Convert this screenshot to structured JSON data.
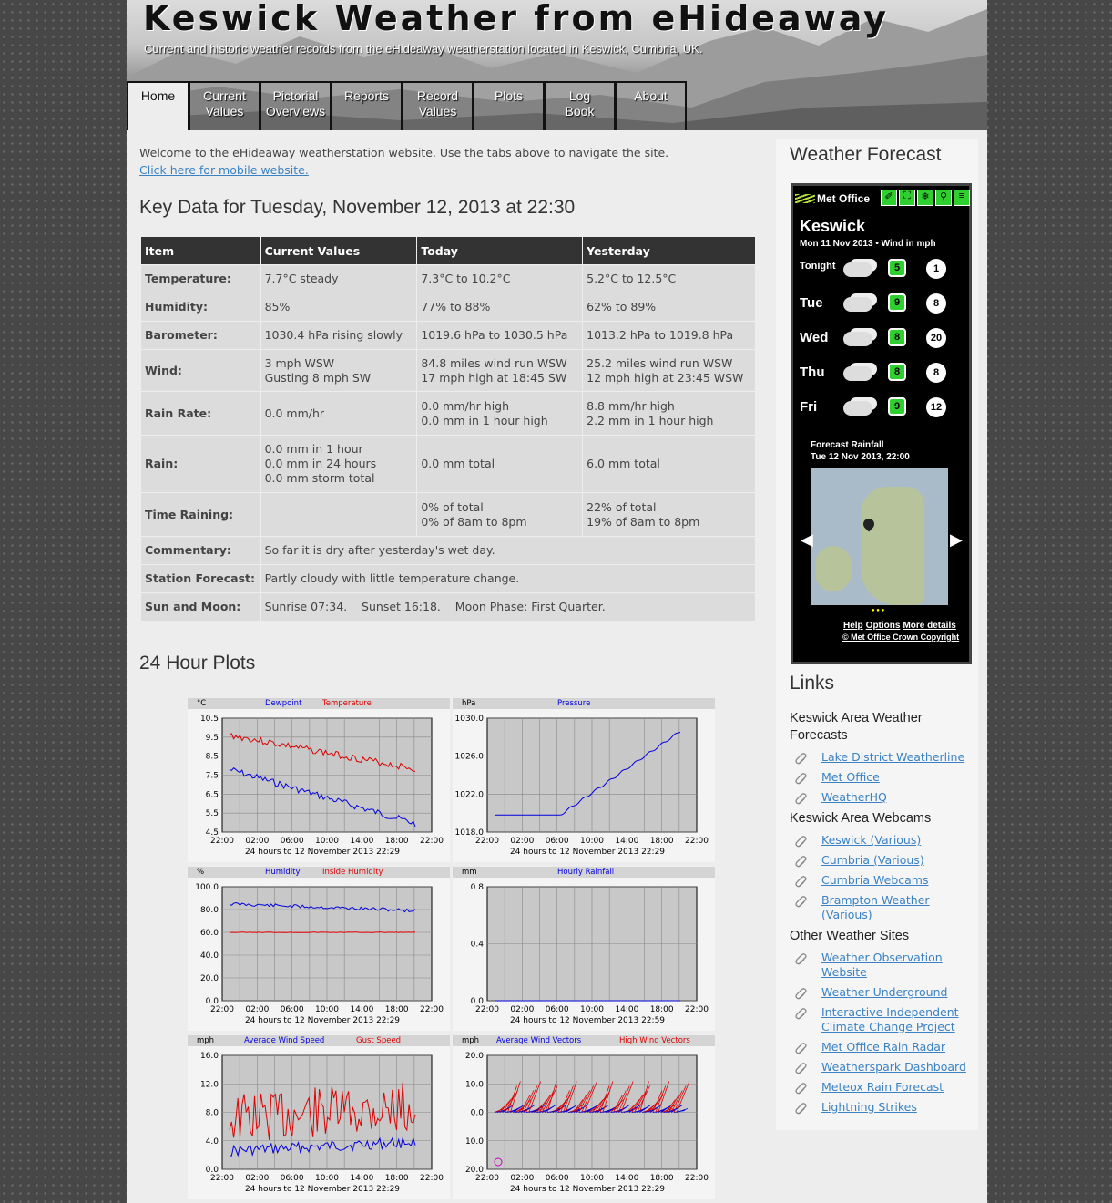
{
  "header": {
    "title": "Keswick Weather from eHideaway",
    "subtitle": "Current and historic weather records from the eHideaway weatherstation located in Keswick, Cumbria, UK."
  },
  "tabs": [
    {
      "line1": "Home",
      "line2": ""
    },
    {
      "line1": "Current",
      "line2": "Values"
    },
    {
      "line1": "Pictorial",
      "line2": "Overviews"
    },
    {
      "line1": "Reports",
      "line2": ""
    },
    {
      "line1": "Record",
      "line2": "Values"
    },
    {
      "line1": "Plots",
      "line2": ""
    },
    {
      "line1": "Log",
      "line2": "Book"
    },
    {
      "line1": "About",
      "line2": ""
    }
  ],
  "intro": {
    "welcome": "Welcome to the eHideaway weatherstation website. Use the tabs above to navigate the site.",
    "mobile_link": "Click here for mobile website."
  },
  "key_data": {
    "title": "Key Data for Tuesday, November 12, 2013 at 22:30",
    "headers": [
      "Item",
      "Current Values",
      "Today",
      "Yesterday"
    ],
    "rows": [
      [
        "Temperature:",
        "7.7°C steady",
        "7.3°C to 10.2°C",
        "5.2°C to 12.5°C"
      ],
      [
        "Humidity:",
        "85%",
        "77% to 88%",
        "62% to 89%"
      ],
      [
        "Barometer:",
        "1030.4 hPa rising slowly",
        "1019.6 hPa to 1030.5 hPa",
        "1013.2 hPa to 1019.8 hPa"
      ],
      [
        "Wind:",
        "3 mph WSW\nGusting 8 mph SW",
        "84.8 miles wind run WSW\n17 mph high at 18:45 SW",
        "25.2 miles wind run WSW\n12 mph high at 23:45 WSW"
      ],
      [
        "Rain Rate:",
        "0.0 mm/hr",
        "0.0 mm/hr high\n0.0 mm in 1 hour high",
        "8.8 mm/hr high\n2.2 mm in 1 hour high"
      ],
      [
        "Rain:",
        "0.0 mm in 1 hour\n0.0 mm in 24 hours\n0.0 mm storm total",
        "0.0 mm total",
        "6.0 mm total"
      ],
      [
        "Time Raining:",
        "",
        "0% of total\n0% of 8am to 8pm",
        "22% of total\n19% of 8am to 8pm"
      ]
    ],
    "wide_rows": [
      [
        "Commentary:",
        "So far it is dry after yesterday's wet day."
      ],
      [
        "Station Forecast:",
        "Partly cloudy with little temperature change."
      ],
      [
        "Sun and Moon:",
        "Sunrise 07:34.    Sunset 16:18.    Moon Phase: First Quarter."
      ]
    ]
  },
  "plots_title": "24 Hour Plots",
  "plots": [
    {
      "id": "temp",
      "units": "°C",
      "series": [
        {
          "name": "Dewpoint",
          "color": "#0000dd"
        },
        {
          "name": "Temperature",
          "color": "#dd0000"
        }
      ],
      "yticks": [
        "10.5",
        "9.5",
        "8.5",
        "7.5",
        "6.5",
        "5.5",
        "4.5"
      ],
      "xticks": [
        "22:00",
        "02:00",
        "06:00",
        "10:00",
        "14:00",
        "18:00",
        "22:00"
      ],
      "caption": "24 hours to 12 November 2013 22:29"
    },
    {
      "id": "pressure",
      "units": "hPa",
      "series": [
        {
          "name": "Pressure",
          "color": "#0000dd"
        }
      ],
      "yticks": [
        "1030.0",
        "1026.0",
        "1022.0",
        "1018.0"
      ],
      "xticks": [
        "22:00",
        "02:00",
        "06:00",
        "10:00",
        "14:00",
        "18:00",
        "22:00"
      ],
      "caption": "24 hours to 12 November 2013 22:29"
    },
    {
      "id": "humidity",
      "units": "%",
      "series": [
        {
          "name": "Humidity",
          "color": "#0000dd"
        },
        {
          "name": "Inside Humidity",
          "color": "#dd0000"
        }
      ],
      "yticks": [
        "100.0",
        "80.0",
        "60.0",
        "40.0",
        "20.0",
        "0.0"
      ],
      "xticks": [
        "22:00",
        "02:00",
        "06:00",
        "10:00",
        "14:00",
        "18:00",
        "22:00"
      ],
      "caption": "24 hours to 12 November 2013 22:29"
    },
    {
      "id": "rain",
      "units": "mm",
      "series": [
        {
          "name": "Hourly Rainfall",
          "color": "#0000dd"
        }
      ],
      "yticks": [
        "0.8",
        "0.4",
        "0.0"
      ],
      "xticks": [
        "22:00",
        "02:00",
        "06:00",
        "10:00",
        "14:00",
        "18:00",
        "22:00"
      ],
      "caption": "24 hours to 12 November 2013 22:59"
    },
    {
      "id": "wind",
      "units": "mph",
      "series": [
        {
          "name": "Average Wind Speed",
          "color": "#0000dd"
        },
        {
          "name": "Gust Speed",
          "color": "#dd0000"
        }
      ],
      "yticks": [
        "16.0",
        "12.0",
        "8.0",
        "4.0",
        "0.0"
      ],
      "xticks": [
        "22:00",
        "02:00",
        "06:00",
        "10:00",
        "14:00",
        "18:00",
        "22:00"
      ],
      "caption": "24 hours to 12 November 2013 22:29"
    },
    {
      "id": "windvec",
      "units": "mph",
      "series": [
        {
          "name": "Average Wind Vectors",
          "color": "#0000dd"
        },
        {
          "name": "High Wind Vectors",
          "color": "#dd0000"
        }
      ],
      "yticks": [
        "20.0",
        "10.0",
        "0.0",
        "10.0",
        "20.0"
      ],
      "xticks": [
        "22:00",
        "02:00",
        "06:00",
        "10:00",
        "14:00",
        "18:00",
        "22:00"
      ],
      "caption": "24 hours to 12 November 2013 22:29"
    }
  ],
  "sidebar": {
    "forecast_title": "Weather Forecast",
    "metoffice": {
      "brand": "Met Office",
      "location": "Keswick",
      "date_line": "Mon 11 Nov 2013 • Wind in mph",
      "days": [
        {
          "day": "Tonight",
          "temp": "5",
          "wind": "1"
        },
        {
          "day": "Tue",
          "temp": "9",
          "wind": "8"
        },
        {
          "day": "Wed",
          "temp": "8",
          "wind": "20"
        },
        {
          "day": "Thu",
          "temp": "8",
          "wind": "8"
        },
        {
          "day": "Fri",
          "temp": "9",
          "wind": "12"
        }
      ],
      "rain_title": "Forecast Rainfall",
      "rain_time": "Tue 12 Nov 2013, 22:00",
      "links": [
        "Help",
        "Options",
        "More details"
      ],
      "copyright": "© Met Office Crown Copyright"
    },
    "links_title": "Links",
    "groups": [
      {
        "title": "Keswick Area Weather Forecasts",
        "items": [
          "Lake District Weatherline",
          "Met Office",
          "WeatherHQ"
        ]
      },
      {
        "title": "Keswick Area Webcams",
        "items": [
          "Keswick (Various)",
          "Cumbria (Various)",
          "Cumbria Webcams",
          "Brampton Weather (Various)"
        ]
      },
      {
        "title": "Other Weather Sites",
        "items": [
          "Weather Observation Website",
          "Weather Underground",
          "Interactive Independent Climate Change Project",
          "Met Office Rain Radar",
          "Weatherspark Dashboard",
          "Meteox Rain Forecast",
          "Lightning Strikes"
        ]
      }
    ]
  }
}
